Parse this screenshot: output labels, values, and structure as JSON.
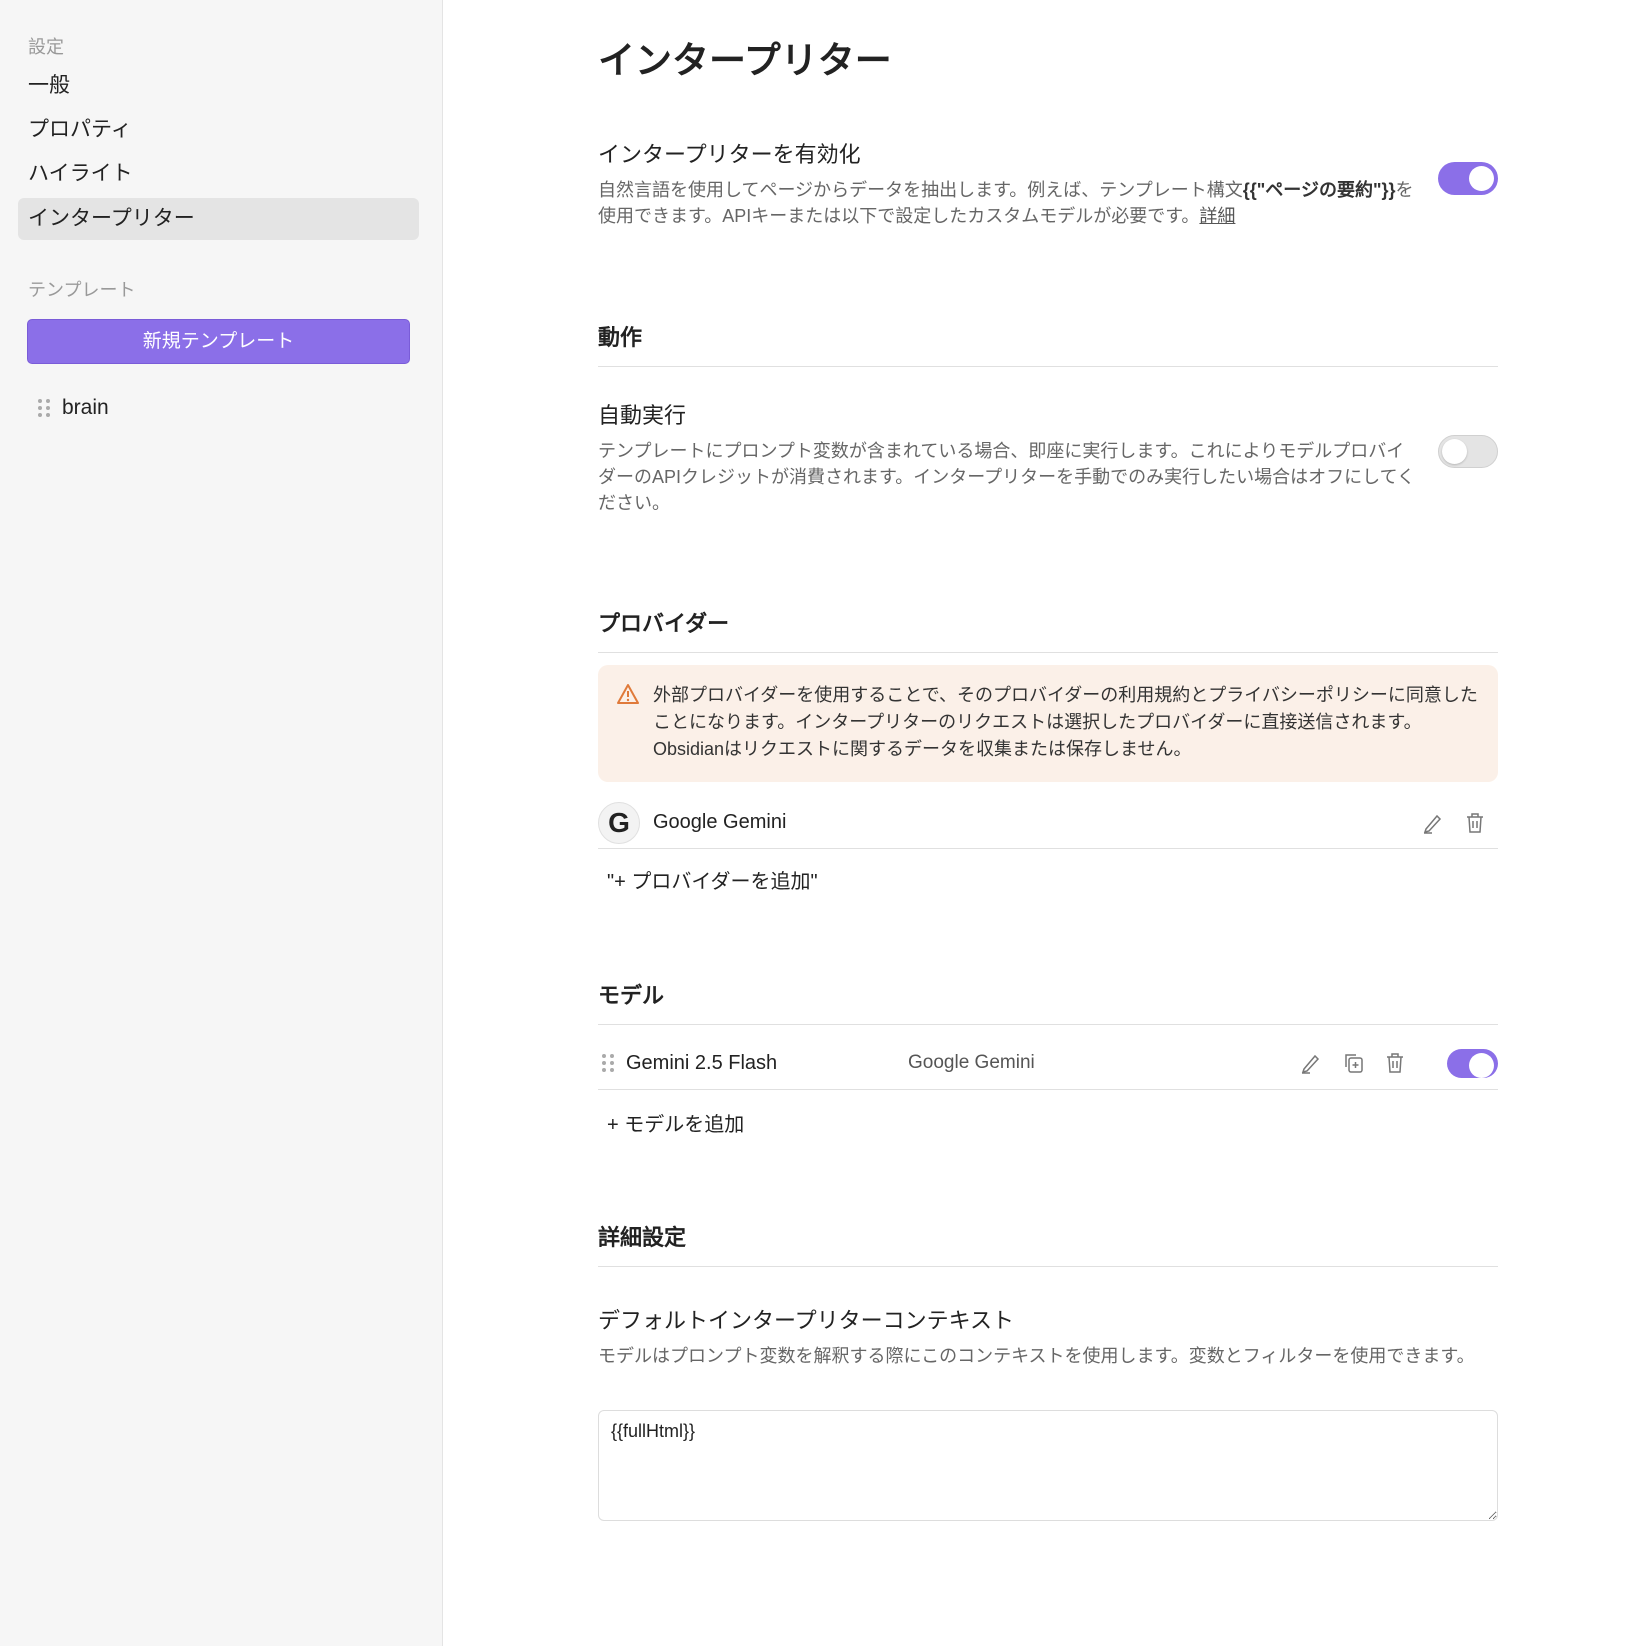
{
  "sidebar": {
    "settings_heading": "設定",
    "items": [
      {
        "label": "一般"
      },
      {
        "label": "プロパティ"
      },
      {
        "label": "ハイライト"
      },
      {
        "label": "インタープリター"
      }
    ],
    "templates_heading": "テンプレート",
    "new_template": "新規テンプレート",
    "templates": [
      {
        "name": "brain"
      }
    ]
  },
  "page": {
    "title": "インタープリター"
  },
  "enable": {
    "name": "インタープリターを有効化",
    "desc1": "自然言語を使用してページからデータを抽出します。例えば、テンプレート構文",
    "desc_code": "{{\"ページの要約\"}}",
    "desc2": "を使用できます。APIキーまたは以下で設定したカスタムモデルが必要です。",
    "more_link": "詳細",
    "enabled": true
  },
  "behavior": {
    "heading": "動作",
    "auto_name": "自動実行",
    "auto_desc": "テンプレートにプロンプト変数が含まれている場合、即座に実行します。これによりモデルプロバイダーのAPIクレジットが消費されます。インタープリターを手動でのみ実行したい場合はオフにしてください。",
    "auto_enabled": false
  },
  "providers": {
    "heading": "プロバイダー",
    "warning": "外部プロバイダーを使用することで、そのプロバイダーの利用規約とプライバシーポリシーに同意したことになります。インタープリターのリクエストは選択したプロバイダーに直接送信されます。Obsidianはリクエストに関するデータを収集または保存しません。",
    "list": [
      {
        "name": "Google Gemini",
        "icon": "G"
      }
    ],
    "add": "\"+ プロバイダーを追加\""
  },
  "models": {
    "heading": "モデル",
    "list": [
      {
        "name": "Gemini 2.5 Flash",
        "provider": "Google Gemini",
        "enabled": true
      }
    ],
    "add": "+ モデルを追加"
  },
  "advanced": {
    "heading": "詳細設定",
    "context_name": "デフォルトインタープリターコンテキスト",
    "context_desc": "モデルはプロンプト変数を解釈する際にこのコンテキストを使用します。変数とフィルターを使用できます。",
    "context_value": "{{fullHtml}}"
  },
  "colors": {
    "accent": "#8b6fe8",
    "warning_bg": "#fbf0e8",
    "warning_icon": "#e07a3a"
  }
}
